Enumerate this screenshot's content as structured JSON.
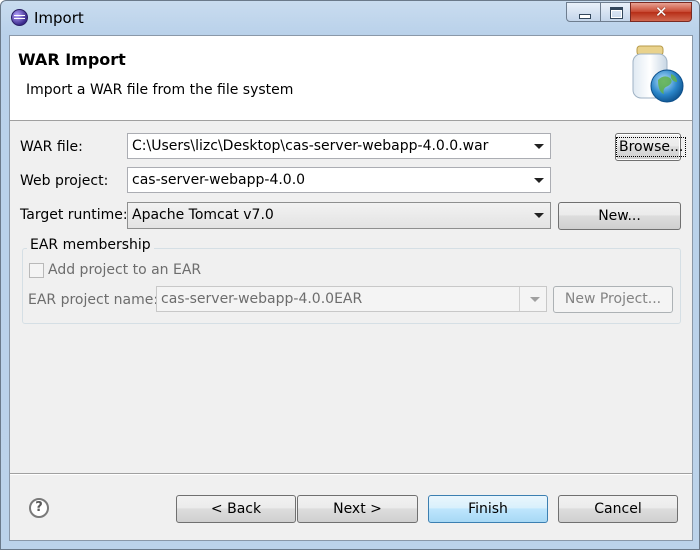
{
  "window": {
    "title": "Import",
    "controls": {
      "minimize_icon": "minimize-icon",
      "maximize_icon": "maximize-icon",
      "close_icon": "close-icon"
    }
  },
  "banner": {
    "title": "WAR Import",
    "description": "Import a WAR file from the file system",
    "image_icon": "jar-globe-icon"
  },
  "form": {
    "war_file": {
      "label": "WAR file:",
      "value": "C:\\Users\\lizc\\Desktop\\cas-server-webapp-4.0.0.war",
      "browse_label": "Browse..."
    },
    "web_project": {
      "label": "Web project:",
      "value": "cas-server-webapp-4.0.0"
    },
    "target_runtime": {
      "label": "Target runtime:",
      "value": "Apache Tomcat v7.0",
      "new_label": "New..."
    }
  },
  "ear": {
    "group_title": "EAR membership",
    "checkbox_label": "Add project to an EAR",
    "checked": false,
    "project_name_label": "EAR project name:",
    "project_name_value": "cas-server-webapp-4.0.0EAR",
    "new_project_label": "New Project..."
  },
  "footer": {
    "help_icon": "help-icon",
    "back_label": "< Back",
    "next_label": "Next >",
    "finish_label": "Finish",
    "cancel_label": "Cancel"
  }
}
